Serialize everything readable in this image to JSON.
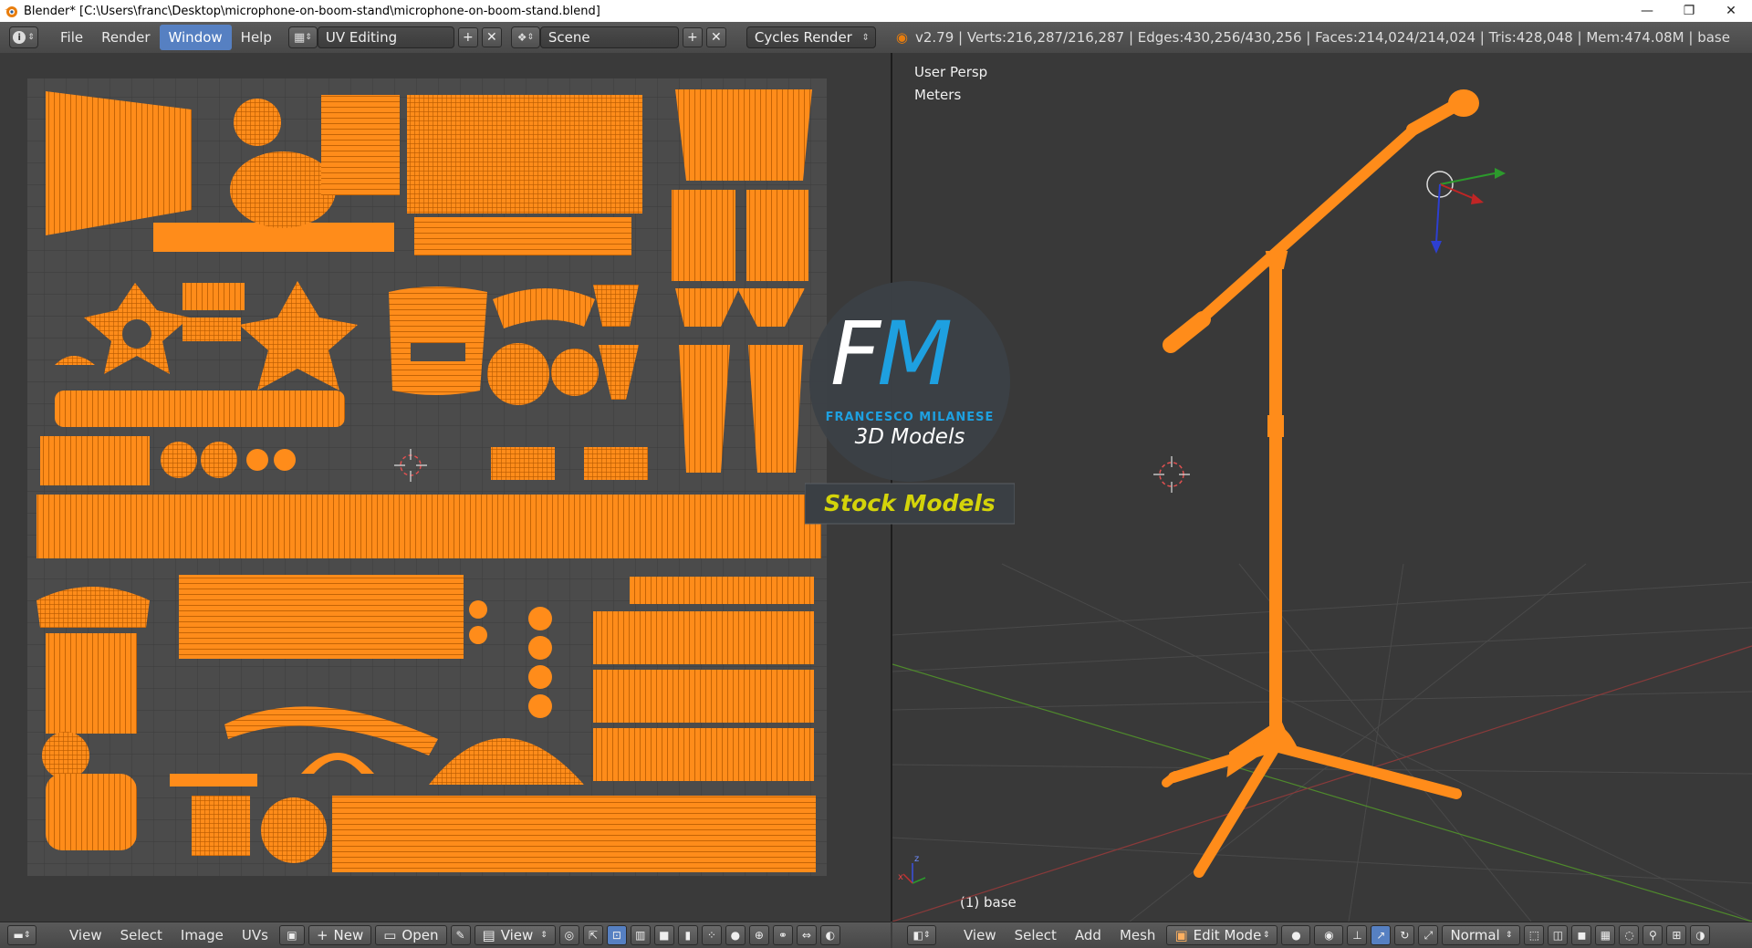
{
  "window": {
    "title": "Blender* [C:\\Users\\franc\\Desktop\\microphone-on-boom-stand\\microphone-on-boom-stand.blend]",
    "minimize": "—",
    "restore": "❐",
    "close": "✕"
  },
  "header": {
    "menus": [
      "File",
      "Render",
      "Window",
      "Help"
    ],
    "active_menu": "Window",
    "layout": "UV Editing",
    "scene": "Scene",
    "render_engine": "Cycles Render",
    "stats": "v2.79 | Verts:216,287/216,287 | Edges:430,256/430,256 | Faces:214,024/214,024 | Tris:428,048 | Mem:474.08M | base"
  },
  "uv_editor": {
    "bottom_menus": [
      "View",
      "Select",
      "Image",
      "UVs"
    ],
    "new_label": "New",
    "open_label": "Open",
    "view_label": "View"
  },
  "viewport": {
    "view_name": "User Persp",
    "units": "Meters",
    "object_label": "(1) base",
    "bottom_menus": [
      "View",
      "Select",
      "Add",
      "Mesh"
    ],
    "mode": "Edit Mode",
    "orientation": "Normal"
  },
  "watermark": {
    "initials_f": "F",
    "initials_m": "M",
    "name": "FRANCESCO MILANESE",
    "subtitle": "3D Models",
    "badge": "Stock Models"
  },
  "colors": {
    "uv_orange": "#ff8c1a",
    "selected_menu": "#5680c2",
    "logo_blue": "#1ea0e0",
    "badge_text": "#d4d40a"
  }
}
